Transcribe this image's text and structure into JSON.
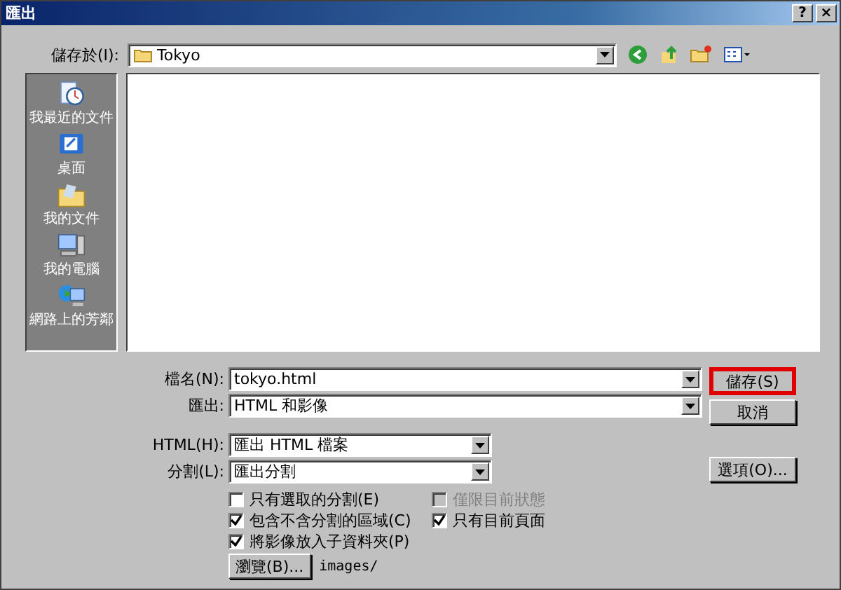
{
  "window": {
    "title": "匯出",
    "help": "?",
    "close": "×"
  },
  "save_in": {
    "label": "儲存於(I):",
    "value": "Tokyo"
  },
  "places": [
    {
      "label": "我最近的文件",
      "kind": "recent"
    },
    {
      "label": "桌面",
      "kind": "desktop"
    },
    {
      "label": "我的文件",
      "kind": "documents"
    },
    {
      "label": "我的電腦",
      "kind": "computer"
    },
    {
      "label": "網路上的芳鄰",
      "kind": "network"
    }
  ],
  "file_name": {
    "label": "檔名(N):",
    "value": "tokyo.html"
  },
  "export_as": {
    "label": "匯出:",
    "value": "HTML 和影像"
  },
  "html": {
    "label": "HTML(H):",
    "value": "匯出 HTML 檔案"
  },
  "slices": {
    "label": "分割(L):",
    "value": "匯出分割"
  },
  "checkboxes": [
    {
      "label": "只有選取的分割(E)",
      "checked": false,
      "disabled": false
    },
    {
      "label": "僅限目前狀態",
      "checked": false,
      "disabled": true
    },
    {
      "label": "包含不含分割的區域(C)",
      "checked": true,
      "disabled": false
    },
    {
      "label": "只有目前頁面",
      "checked": true,
      "disabled": false
    },
    {
      "label": "將影像放入子資料夾(P)",
      "checked": true,
      "disabled": false
    }
  ],
  "browse": {
    "label": "瀏覽(B)...",
    "path": "images/"
  },
  "buttons": {
    "save": {
      "label": "儲存(S)",
      "highlighted": true
    },
    "cancel": {
      "label": "取消"
    },
    "options": {
      "label": "選項(O)..."
    }
  }
}
